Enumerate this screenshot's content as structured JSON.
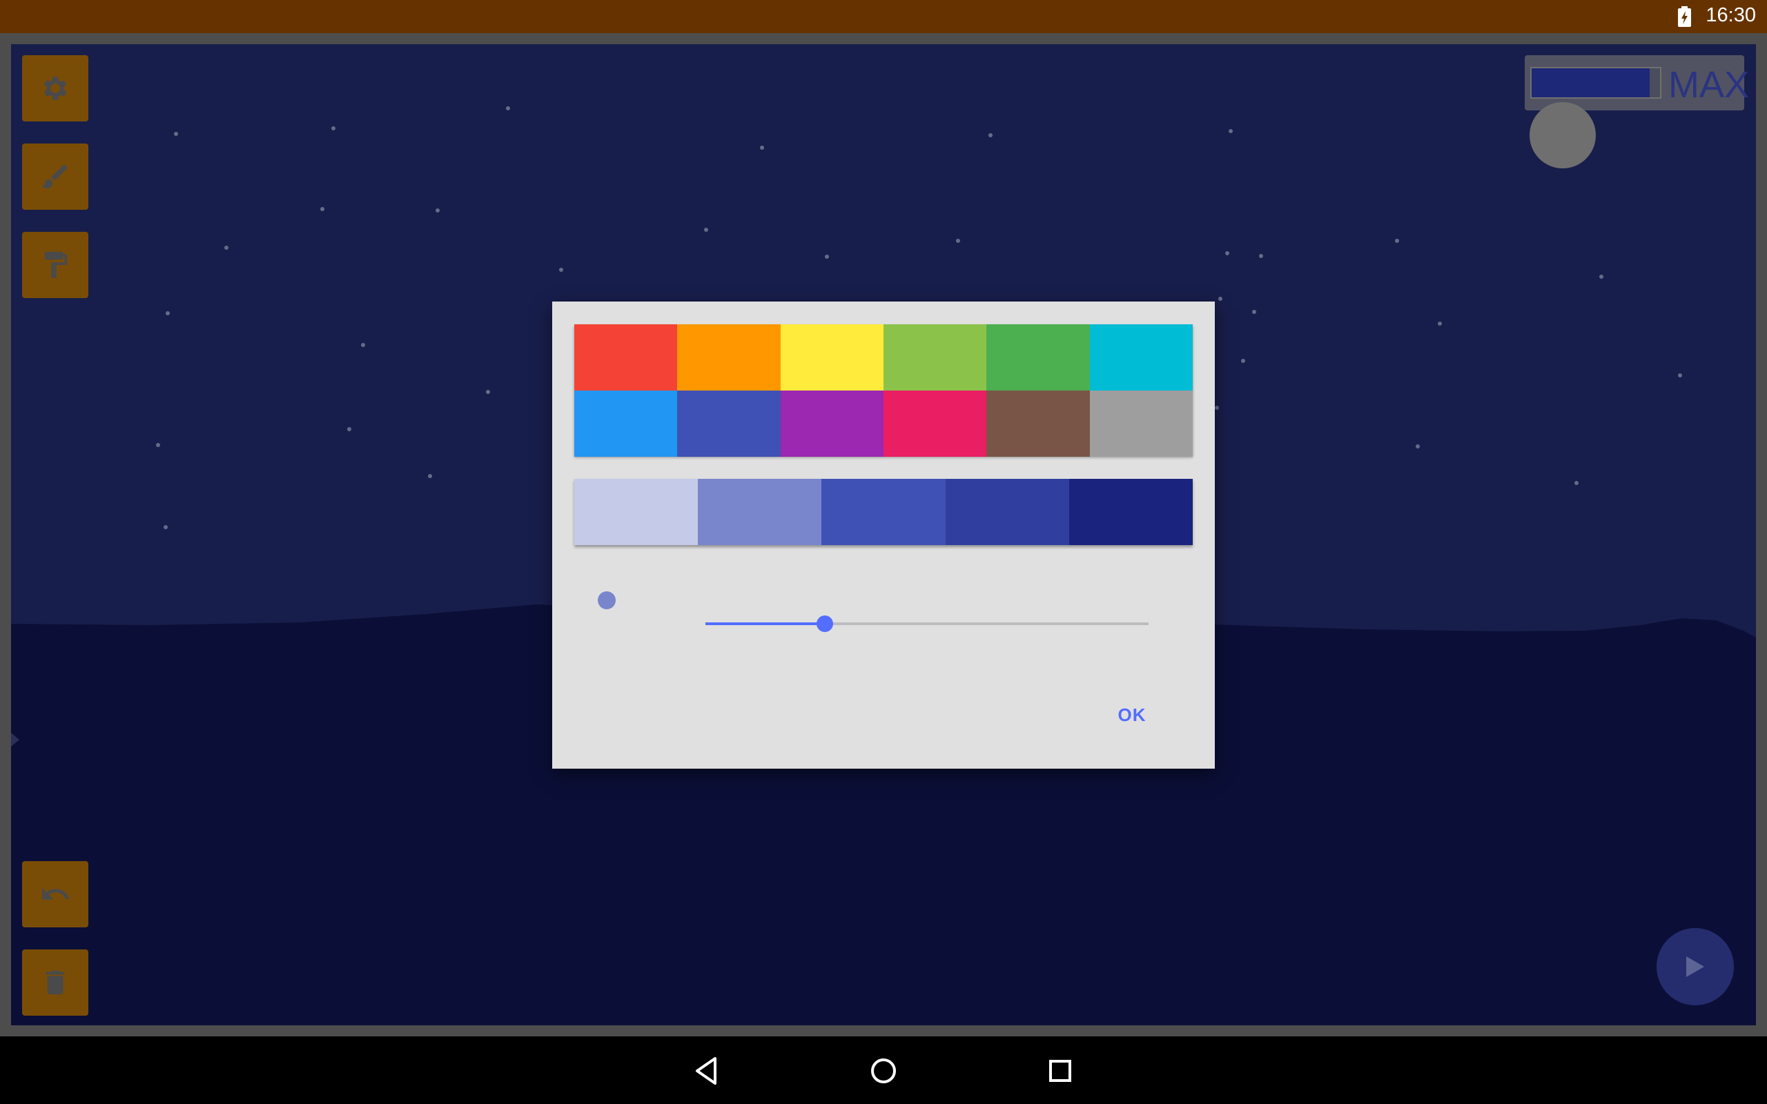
{
  "status_bar": {
    "time": "16:30",
    "battery_icon": "battery-charging-icon",
    "background": "#663300"
  },
  "canvas": {
    "sky_color": "#1a2050",
    "ground_color": "#0c103a"
  },
  "toolbar": {
    "accent": "#7a4d06",
    "top_tools": [
      {
        "name": "settings-button",
        "icon": "gear-icon"
      },
      {
        "name": "brush-button",
        "icon": "brush-icon"
      },
      {
        "name": "fill-button",
        "icon": "paint-roller-icon"
      }
    ],
    "bottom_tools": [
      {
        "name": "undo-button",
        "icon": "undo-icon"
      },
      {
        "name": "delete-button",
        "icon": "trash-icon"
      }
    ]
  },
  "brush_size": {
    "label": "MAX",
    "level_fraction": 0.92
  },
  "color_dialog": {
    "palette": [
      "#f44336",
      "#ff9800",
      "#ffeb3b",
      "#8bc34a",
      "#4caf50",
      "#00bcd4",
      "#2196f3",
      "#3f51b5",
      "#9c27b0",
      "#e91e63",
      "#795548",
      "#9e9e9e"
    ],
    "shades": [
      "#c5cae9",
      "#7986cb",
      "#3f51b5",
      "#303f9f",
      "#1a237e"
    ],
    "selected_color": "#7986cb",
    "opacity_slider_fraction": 0.27,
    "ok_label": "OK",
    "accent": "#536dfe"
  },
  "play_button": {
    "icon": "play-icon"
  },
  "nav_bar": {
    "buttons": [
      "back-icon",
      "home-icon",
      "recents-icon"
    ]
  }
}
